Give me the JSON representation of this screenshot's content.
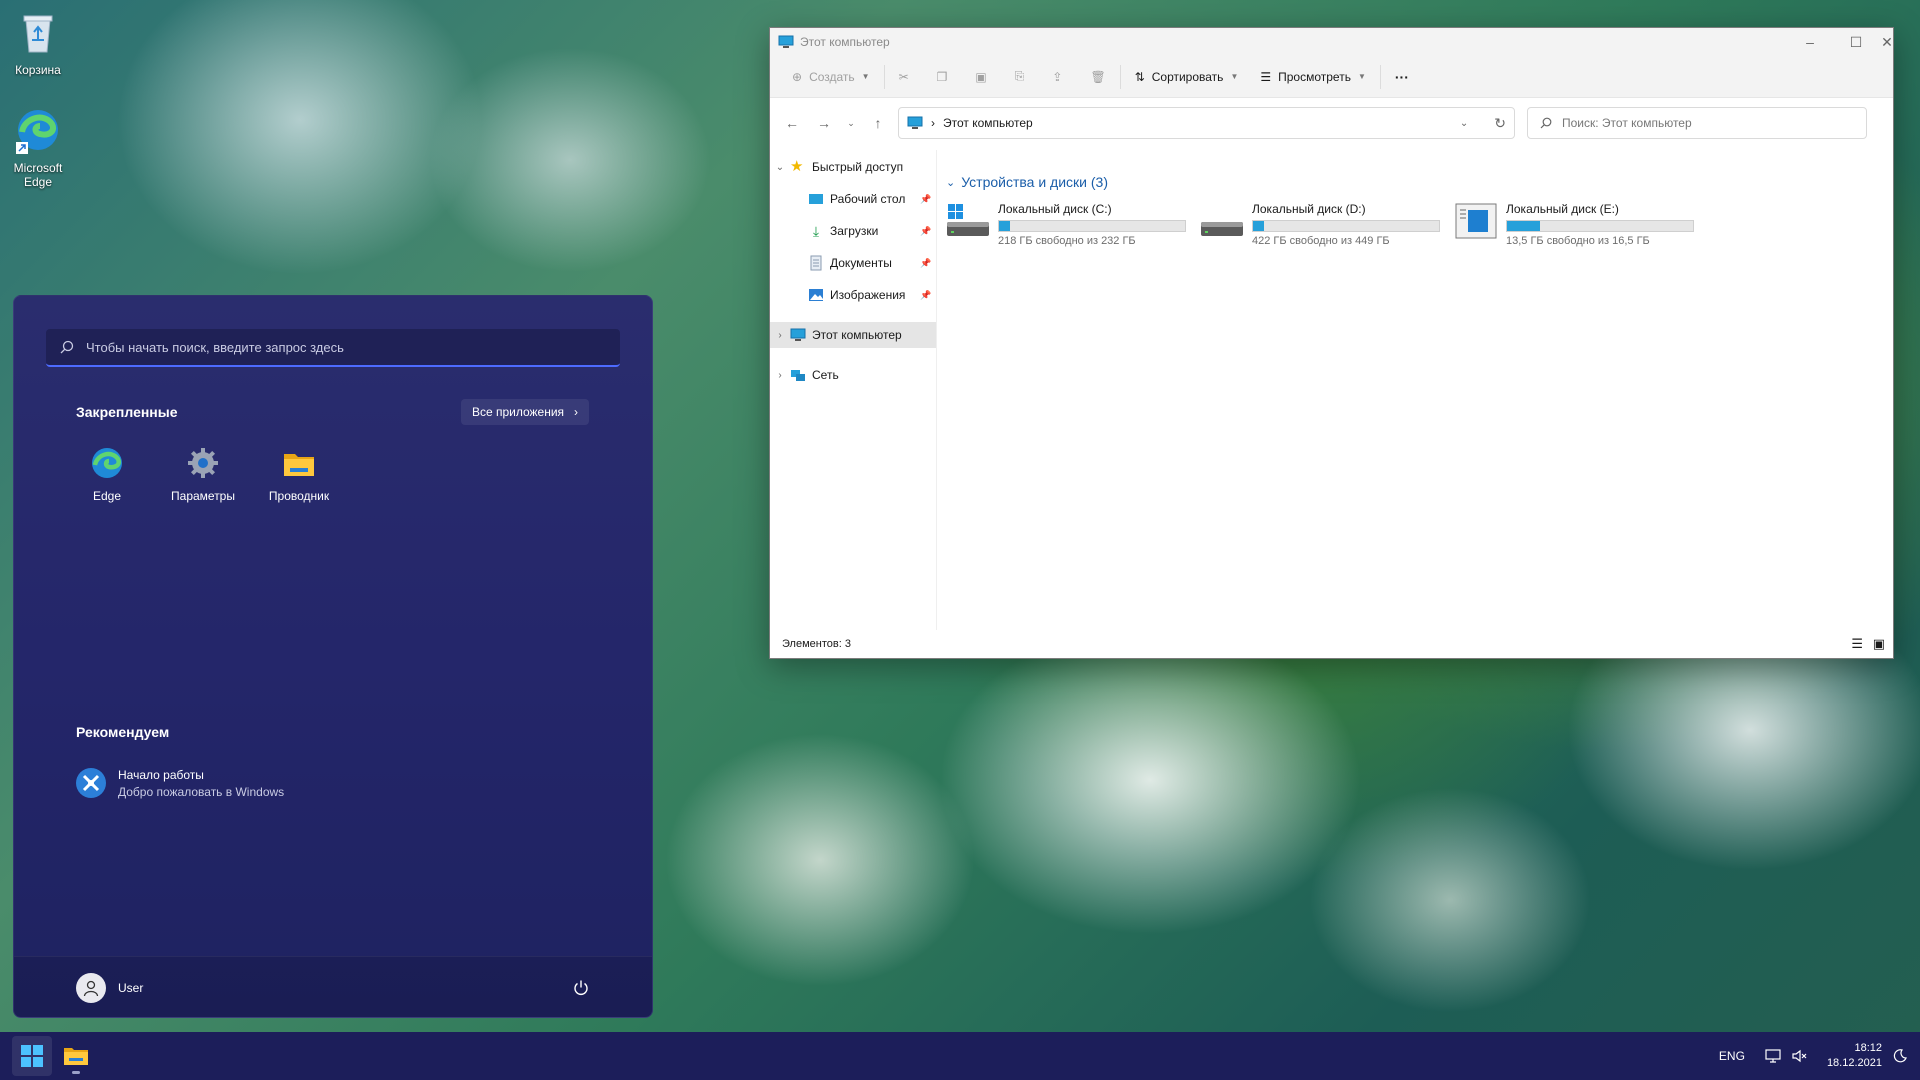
{
  "desktop": {
    "icons": [
      {
        "label": "Корзина"
      },
      {
        "label": "Microsoft Edge"
      }
    ]
  },
  "start_menu": {
    "search_placeholder": "Чтобы начать поиск, введите запрос здесь",
    "pinned_heading": "Закрепленные",
    "all_apps_label": "Все приложения",
    "pinned": [
      {
        "label": "Edge",
        "icon": "edge-icon"
      },
      {
        "label": "Параметры",
        "icon": "gear-icon"
      },
      {
        "label": "Проводник",
        "icon": "folder-icon"
      }
    ],
    "recommended_heading": "Рекомендуем",
    "recommended": [
      {
        "title": "Начало работы",
        "subtitle": "Добро пожаловать в Windows"
      }
    ],
    "user_name": "User"
  },
  "explorer": {
    "window_title": "Этот компьютер",
    "commands": {
      "create": "Создать",
      "sort": "Сортировать",
      "view": "Просмотреть",
      "more": "···"
    },
    "address": "Этот компьютер",
    "search_placeholder": "Поиск: Этот компьютер",
    "nav": {
      "quick_access": "Быстрый доступ",
      "desktop": "Рабочий стол",
      "downloads": "Загрузки",
      "documents": "Документы",
      "pictures": "Изображения",
      "this_pc": "Этот компьютер",
      "network": "Сеть"
    },
    "group_header": "Устройства и диски (3)",
    "drives": [
      {
        "name": "Локальный диск (C:)",
        "free": "218 ГБ свободно из 232 ГБ",
        "used_fraction": 0.06
      },
      {
        "name": "Локальный диск (D:)",
        "free": "422 ГБ свободно из 449 ГБ",
        "used_fraction": 0.06
      },
      {
        "name": "Локальный диск (E:)",
        "free": "13,5 ГБ свободно из 16,5 ГБ",
        "used_fraction": 0.18
      }
    ],
    "status": "Элементов: 3"
  },
  "taskbar": {
    "language": "ENG",
    "time": "18:12",
    "date": "18.12.2021"
  },
  "colors": {
    "accent": "#26a0da",
    "start_bg": "#24266a",
    "taskbar_bg": "#1c1e5a",
    "link_blue": "#1b5ea9"
  }
}
